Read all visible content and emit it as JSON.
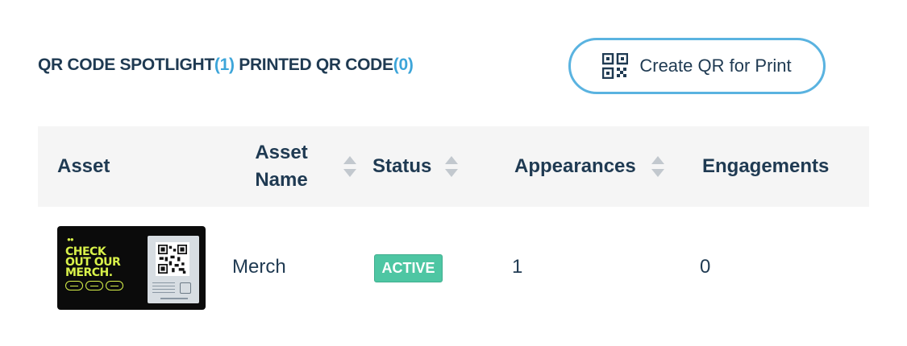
{
  "tabs": [
    {
      "label": "QR CODE SPOTLIGHT",
      "count": "(1)"
    },
    {
      "label": "PRINTED QR CODE",
      "count": "(0)"
    }
  ],
  "create_button": {
    "label": "Create QR for Print",
    "icon": "qr-code-icon"
  },
  "table": {
    "columns": [
      {
        "label": "Asset",
        "sortable": false
      },
      {
        "label": "Asset Name",
        "sortable": true
      },
      {
        "label": "Status",
        "sortable": true
      },
      {
        "label": "Appearances",
        "sortable": true
      },
      {
        "label": "Engagements",
        "sortable": false
      }
    ],
    "rows": [
      {
        "thumbnail_text": "CHECK OUT OUR MERCH.",
        "asset_name": "Merch",
        "status": "ACTIVE",
        "appearances": "1",
        "engagements": "0"
      }
    ]
  },
  "colors": {
    "text": "#1f3a52",
    "accent": "#3da5d9",
    "button_border": "#5ab3e0",
    "active_badge": "#4ec6a3",
    "header_bg": "#f5f5f5",
    "thumbnail_lime": "#d9f24a"
  }
}
